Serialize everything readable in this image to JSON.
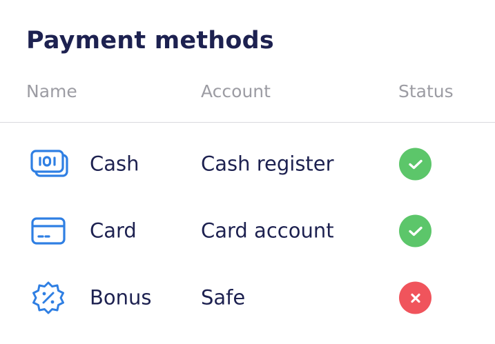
{
  "title": "Payment methods",
  "columns": {
    "name": "Name",
    "account": "Account",
    "status": "Status"
  },
  "rows": [
    {
      "name": "Cash",
      "account": "Cash register",
      "status": "active",
      "icon": "cash-icon",
      "status_color": "#5cc66a"
    },
    {
      "name": "Card",
      "account": "Card account",
      "status": "active",
      "icon": "card-icon",
      "status_color": "#5cc66a"
    },
    {
      "name": "Bonus",
      "account": "Safe",
      "status": "inactive",
      "icon": "bonus-percent-icon",
      "status_color": "#f0545c"
    }
  ],
  "colors": {
    "text": "#1d2150",
    "header_text": "#9c9ca3",
    "icon_blue": "#2f7fe3",
    "success": "#5cc66a",
    "error": "#f0545c"
  }
}
